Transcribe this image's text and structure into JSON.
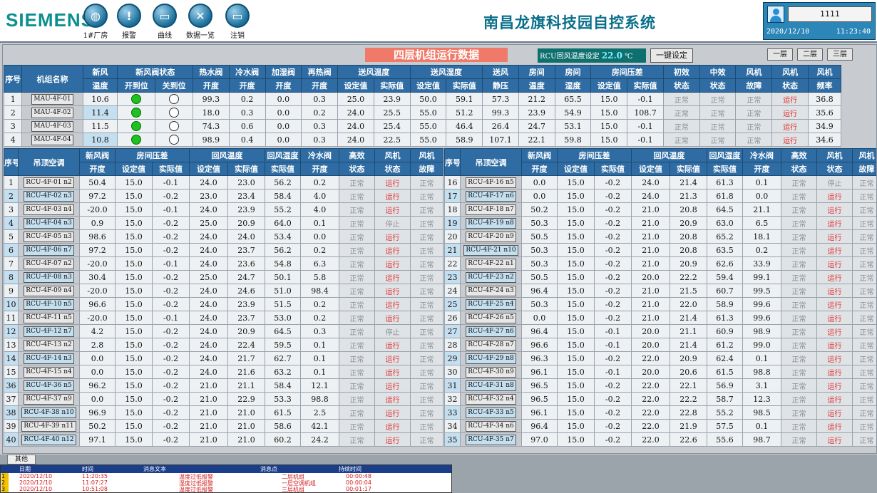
{
  "header": {
    "brand": "SIEMENS",
    "nav": [
      {
        "label": "1#厂房",
        "icon": "globe-icon",
        "glyph": "◍"
      },
      {
        "label": "报警",
        "icon": "alarm-warning-icon",
        "glyph": "!"
      },
      {
        "label": "曲线",
        "icon": "folder-curve-icon",
        "glyph": "▭"
      },
      {
        "label": "数据一览",
        "icon": "tools-icon",
        "glyph": "✕"
      },
      {
        "label": "注销",
        "icon": "folder-logout-icon",
        "glyph": "▭"
      }
    ],
    "title": "南昌龙旗科技园自控系统",
    "user": "1111",
    "date": "2020/12/10",
    "time": "11:23:40"
  },
  "panel": {
    "title": "四层机组运行数据",
    "rcu_label": "RCU回风温度设定",
    "rcu_value": "22.0",
    "rcu_unit": "℃",
    "set_button": "一键设定",
    "floors": [
      "一层",
      "二层",
      "三层"
    ]
  },
  "mau": {
    "rows": [
      {
        "no": "1",
        "name": "MAU-4F-01",
        "fresh": "10.6",
        "valve_open": true,
        "supply_valve": "99.3",
        "cold_valve": "0.2",
        "humid_valve": "0.0",
        "reheat_valve": "0.3",
        "st_set": "25.0",
        "st_act": "23.9",
        "sh_set": "50.0",
        "sh_act": "59.1",
        "static_p": "57.3",
        "room_t": "21.2",
        "room_h": "65.5",
        "rp_set": "15.0",
        "rp_act": "-0.1",
        "f1": "正常",
        "f2": "正常",
        "fault": "正常",
        "run": "运行",
        "freq": "36.8"
      },
      {
        "no": "2",
        "name": "MAU-4F-02",
        "fresh": "11.4",
        "valve_open": true,
        "supply_valve": "18.0",
        "cold_valve": "0.3",
        "humid_valve": "0.0",
        "reheat_valve": "0.2",
        "st_set": "24.0",
        "st_act": "25.5",
        "sh_set": "55.0",
        "sh_act": "51.2",
        "static_p": "99.3",
        "room_t": "23.9",
        "room_h": "54.9",
        "rp_set": "15.0",
        "rp_act": "108.7",
        "f1": "正常",
        "f2": "正常",
        "fault": "正常",
        "run": "运行",
        "freq": "35.6"
      },
      {
        "no": "3",
        "name": "MAU-4F-03",
        "fresh": "11.5",
        "valve_open": true,
        "supply_valve": "74.3",
        "cold_valve": "0.6",
        "humid_valve": "0.0",
        "reheat_valve": "0.3",
        "st_set": "24.0",
        "st_act": "25.4",
        "sh_set": "55.0",
        "sh_act": "46.4",
        "static_p": "26.4",
        "room_t": "24.7",
        "room_h": "53.1",
        "rp_set": "15.0",
        "rp_act": "-0.1",
        "f1": "正常",
        "f2": "正常",
        "fault": "正常",
        "run": "运行",
        "freq": "34.9"
      },
      {
        "no": "4",
        "name": "MAU-4F-04",
        "fresh": "10.8",
        "valve_open": true,
        "supply_valve": "98.9",
        "cold_valve": "0.4",
        "humid_valve": "0.0",
        "reheat_valve": "0.3",
        "st_set": "24.0",
        "st_act": "22.5",
        "sh_set": "55.0",
        "sh_act": "58.9",
        "static_p": "107.1",
        "room_t": "22.1",
        "room_h": "59.8",
        "rp_set": "15.0",
        "rp_act": "-0.1",
        "f1": "正常",
        "f2": "正常",
        "fault": "正常",
        "run": "运行",
        "freq": "34.6"
      }
    ],
    "headers": {
      "no": "序号",
      "name": "机组名称",
      "fresh": "新风",
      "fresh_sub": "温度",
      "valve_state": "新风阀状态",
      "open_pos": "开到位",
      "close_pos": "关到位",
      "hot_valve": "热水阀",
      "cold_valve": "冷水阀",
      "humid_valve": "加湿阀",
      "reheat_valve": "再热阀",
      "open": "开度",
      "supply_temp": "送风温度",
      "supply_humid": "送风湿度",
      "set": "设定值",
      "act": "实际值",
      "supply_air": "送风",
      "static": "静压",
      "room": "房间",
      "temp": "温度",
      "humid": "湿度",
      "room_press": "房间压差",
      "primary": "初效",
      "medium": "中效",
      "state": "状态",
      "fan": "风机",
      "fault": "故障",
      "freq": "频率"
    }
  },
  "rcu_headers": {
    "no": "序号",
    "name": "吊顶空调",
    "fresh_valve": "新风阀",
    "open": "开度",
    "room_press": "房间压差",
    "set": "设定值",
    "act": "实际值",
    "return_temp": "回风温度",
    "return_humid": "回风湿度",
    "cold_valve": "冷水阀",
    "high_eff": "高效",
    "state": "状态",
    "fan": "风机",
    "fault": "故障"
  },
  "rcu_left": [
    {
      "no": "1",
      "name": "RCU-4F-01 n2",
      "fv": "50.4",
      "ps": "15.0",
      "pa": "-0.1",
      "ts": "24.0",
      "ta": "23.0",
      "ha": "56.2",
      "cv": "0.2",
      "he": "正常",
      "fan": "运行",
      "ft": "正常"
    },
    {
      "no": "2",
      "name": "RCU-4F-02 n3",
      "fv": "97.2",
      "ps": "15.0",
      "pa": "-0.2",
      "ts": "23.0",
      "ta": "23.4",
      "ha": "58.4",
      "cv": "4.0",
      "he": "正常",
      "fan": "运行",
      "ft": "正常"
    },
    {
      "no": "3",
      "name": "RCU-4F-03 n4",
      "fv": "-20.0",
      "ps": "15.0",
      "pa": "-0.1",
      "ts": "24.0",
      "ta": "23.9",
      "ha": "55.2",
      "cv": "4.0",
      "he": "正常",
      "fan": "运行",
      "ft": "正常"
    },
    {
      "no": "4",
      "name": "RCU-4F-04 n3",
      "fv": "0.9",
      "ps": "15.0",
      "pa": "-0.2",
      "ts": "25.0",
      "ta": "20.9",
      "ha": "64.0",
      "cv": "0.1",
      "he": "正常",
      "fan": "停止",
      "ft": "正常"
    },
    {
      "no": "5",
      "name": "RCU-4F-05 n3",
      "fv": "98.6",
      "ps": "15.0",
      "pa": "-0.2",
      "ts": "24.0",
      "ta": "24.0",
      "ha": "53.4",
      "cv": "0.0",
      "he": "正常",
      "fan": "运行",
      "ft": "正常"
    },
    {
      "no": "6",
      "name": "RCU-4F-06 n7",
      "fv": "97.2",
      "ps": "15.0",
      "pa": "-0.2",
      "ts": "24.0",
      "ta": "23.7",
      "ha": "56.2",
      "cv": "0.2",
      "he": "正常",
      "fan": "运行",
      "ft": "正常"
    },
    {
      "no": "7",
      "name": "RCU-4F-07 n2",
      "fv": "-20.0",
      "ps": "15.0",
      "pa": "-0.1",
      "ts": "24.0",
      "ta": "23.6",
      "ha": "54.8",
      "cv": "6.3",
      "he": "正常",
      "fan": "运行",
      "ft": "正常"
    },
    {
      "no": "8",
      "name": "RCU-4F-08 n3",
      "fv": "30.4",
      "ps": "15.0",
      "pa": "-0.2",
      "ts": "25.0",
      "ta": "24.7",
      "ha": "50.1",
      "cv": "5.8",
      "he": "正常",
      "fan": "运行",
      "ft": "正常"
    },
    {
      "no": "9",
      "name": "RCU-4F-09 n4",
      "fv": "-20.0",
      "ps": "15.0",
      "pa": "-0.2",
      "ts": "24.0",
      "ta": "24.6",
      "ha": "51.0",
      "cv": "98.4",
      "he": "正常",
      "fan": "运行",
      "ft": "正常"
    },
    {
      "no": "10",
      "name": "RCU-4F-10 n5",
      "fv": "96.6",
      "ps": "15.0",
      "pa": "-0.2",
      "ts": "24.0",
      "ta": "23.9",
      "ha": "51.5",
      "cv": "0.2",
      "he": "正常",
      "fan": "运行",
      "ft": "正常"
    },
    {
      "no": "11",
      "name": "RCU-4F-11 n5",
      "fv": "-20.0",
      "ps": "15.0",
      "pa": "-0.1",
      "ts": "24.0",
      "ta": "23.7",
      "ha": "53.0",
      "cv": "0.2",
      "he": "正常",
      "fan": "运行",
      "ft": "正常"
    },
    {
      "no": "12",
      "name": "RCU-4F-12 n7",
      "fv": "4.2",
      "ps": "15.0",
      "pa": "-0.2",
      "ts": "24.0",
      "ta": "20.9",
      "ha": "64.5",
      "cv": "0.3",
      "he": "正常",
      "fan": "停止",
      "ft": "正常"
    },
    {
      "no": "13",
      "name": "RCU-4F-13 n2",
      "fv": "2.8",
      "ps": "15.0",
      "pa": "-0.2",
      "ts": "24.0",
      "ta": "22.4",
      "ha": "59.5",
      "cv": "0.1",
      "he": "正常",
      "fan": "运行",
      "ft": "正常"
    },
    {
      "no": "14",
      "name": "RCU-4F-14 n3",
      "fv": "0.0",
      "ps": "15.0",
      "pa": "-0.2",
      "ts": "24.0",
      "ta": "21.7",
      "ha": "62.7",
      "cv": "0.1",
      "he": "正常",
      "fan": "运行",
      "ft": "正常"
    },
    {
      "no": "15",
      "name": "RCU-4F-15 n4",
      "fv": "0.0",
      "ps": "15.0",
      "pa": "-0.2",
      "ts": "24.0",
      "ta": "21.6",
      "ha": "63.2",
      "cv": "0.1",
      "he": "正常",
      "fan": "运行",
      "ft": "正常"
    },
    {
      "no": "36",
      "name": "RCU-4F-36 n5",
      "fv": "96.2",
      "ps": "15.0",
      "pa": "-0.2",
      "ts": "21.0",
      "ta": "21.1",
      "ha": "58.4",
      "cv": "12.1",
      "he": "正常",
      "fan": "运行",
      "ft": "正常"
    },
    {
      "no": "37",
      "name": "RCU-4F-37 n9",
      "fv": "0.0",
      "ps": "15.0",
      "pa": "-0.2",
      "ts": "21.0",
      "ta": "22.9",
      "ha": "53.3",
      "cv": "98.8",
      "he": "正常",
      "fan": "运行",
      "ft": "正常"
    },
    {
      "no": "38",
      "name": "RCU-4F-38 n10",
      "fv": "96.9",
      "ps": "15.0",
      "pa": "-0.2",
      "ts": "21.0",
      "ta": "21.0",
      "ha": "61.5",
      "cv": "2.5",
      "he": "正常",
      "fan": "运行",
      "ft": "正常"
    },
    {
      "no": "39",
      "name": "RCU-4F-39 n11",
      "fv": "50.2",
      "ps": "15.0",
      "pa": "-0.2",
      "ts": "21.0",
      "ta": "21.0",
      "ha": "58.6",
      "cv": "42.1",
      "he": "正常",
      "fan": "运行",
      "ft": "正常"
    },
    {
      "no": "40",
      "name": "RCU-4F-40 n12",
      "fv": "97.1",
      "ps": "15.0",
      "pa": "-0.2",
      "ts": "21.0",
      "ta": "21.0",
      "ha": "60.2",
      "cv": "24.2",
      "he": "正常",
      "fan": "运行",
      "ft": "正常"
    }
  ],
  "rcu_right": [
    {
      "no": "16",
      "name": "RCU-4F-16 n5",
      "fv": "0.0",
      "ps": "15.0",
      "pa": "-0.2",
      "ts": "24.0",
      "ta": "21.4",
      "ha": "61.3",
      "cv": "0.1",
      "he": "正常",
      "fan": "停止",
      "ft": "正常"
    },
    {
      "no": "17",
      "name": "RCU-4F-17 n6",
      "fv": "0.0",
      "ps": "15.0",
      "pa": "-0.2",
      "ts": "24.0",
      "ta": "21.3",
      "ha": "61.8",
      "cv": "0.0",
      "he": "正常",
      "fan": "运行",
      "ft": "正常"
    },
    {
      "no": "18",
      "name": "RCU-4F-18 n7",
      "fv": "50.2",
      "ps": "15.0",
      "pa": "-0.2",
      "ts": "21.0",
      "ta": "20.8",
      "ha": "64.5",
      "cv": "21.1",
      "he": "正常",
      "fan": "运行",
      "ft": "正常"
    },
    {
      "no": "19",
      "name": "RCU-4F-19 n8",
      "fv": "50.3",
      "ps": "15.0",
      "pa": "-0.2",
      "ts": "21.0",
      "ta": "20.9",
      "ha": "63.0",
      "cv": "6.5",
      "he": "正常",
      "fan": "运行",
      "ft": "正常"
    },
    {
      "no": "20",
      "name": "RCU-4F-20 n9",
      "fv": "50.5",
      "ps": "15.0",
      "pa": "-0.2",
      "ts": "21.0",
      "ta": "20.8",
      "ha": "65.2",
      "cv": "18.1",
      "he": "正常",
      "fan": "运行",
      "ft": "正常"
    },
    {
      "no": "21",
      "name": "RCU-4F-21 n10",
      "fv": "50.3",
      "ps": "15.0",
      "pa": "-0.2",
      "ts": "21.0",
      "ta": "20.8",
      "ha": "63.5",
      "cv": "0.2",
      "he": "正常",
      "fan": "运行",
      "ft": "正常"
    },
    {
      "no": "22",
      "name": "RCU-4F-22 n1",
      "fv": "50.3",
      "ps": "15.0",
      "pa": "-0.2",
      "ts": "21.0",
      "ta": "20.9",
      "ha": "62.6",
      "cv": "33.9",
      "he": "正常",
      "fan": "运行",
      "ft": "正常"
    },
    {
      "no": "23",
      "name": "RCU-4F-23 n2",
      "fv": "50.5",
      "ps": "15.0",
      "pa": "-0.2",
      "ts": "20.0",
      "ta": "22.2",
      "ha": "59.4",
      "cv": "99.1",
      "he": "正常",
      "fan": "运行",
      "ft": "正常"
    },
    {
      "no": "24",
      "name": "RCU-4F-24 n3",
      "fv": "96.4",
      "ps": "15.0",
      "pa": "-0.2",
      "ts": "21.0",
      "ta": "21.5",
      "ha": "60.7",
      "cv": "99.5",
      "he": "正常",
      "fan": "运行",
      "ft": "正常"
    },
    {
      "no": "25",
      "name": "RCU-4F-25 n4",
      "fv": "50.3",
      "ps": "15.0",
      "pa": "-0.2",
      "ts": "21.0",
      "ta": "22.0",
      "ha": "58.9",
      "cv": "99.6",
      "he": "正常",
      "fan": "运行",
      "ft": "正常"
    },
    {
      "no": "26",
      "name": "RCU-4F-26 n5",
      "fv": "0.0",
      "ps": "15.0",
      "pa": "-0.2",
      "ts": "21.0",
      "ta": "21.4",
      "ha": "61.3",
      "cv": "99.6",
      "he": "正常",
      "fan": "运行",
      "ft": "正常"
    },
    {
      "no": "27",
      "name": "RCU-4F-27 n6",
      "fv": "96.4",
      "ps": "15.0",
      "pa": "-0.1",
      "ts": "20.0",
      "ta": "21.1",
      "ha": "60.9",
      "cv": "98.9",
      "he": "正常",
      "fan": "运行",
      "ft": "正常"
    },
    {
      "no": "28",
      "name": "RCU-4F-28 n7",
      "fv": "96.6",
      "ps": "15.0",
      "pa": "-0.1",
      "ts": "20.0",
      "ta": "21.4",
      "ha": "61.2",
      "cv": "99.0",
      "he": "正常",
      "fan": "运行",
      "ft": "正常"
    },
    {
      "no": "29",
      "name": "RCU-4F-29 n8",
      "fv": "96.3",
      "ps": "15.0",
      "pa": "-0.2",
      "ts": "22.0",
      "ta": "20.9",
      "ha": "62.4",
      "cv": "0.1",
      "he": "正常",
      "fan": "运行",
      "ft": "正常"
    },
    {
      "no": "30",
      "name": "RCU-4F-30 n9",
      "fv": "96.1",
      "ps": "15.0",
      "pa": "-0.1",
      "ts": "20.0",
      "ta": "20.6",
      "ha": "61.5",
      "cv": "98.8",
      "he": "正常",
      "fan": "运行",
      "ft": "正常"
    },
    {
      "no": "31",
      "name": "RCU-4F-31 n8",
      "fv": "96.5",
      "ps": "15.0",
      "pa": "-0.2",
      "ts": "22.0",
      "ta": "22.1",
      "ha": "56.9",
      "cv": "3.1",
      "he": "正常",
      "fan": "运行",
      "ft": "正常"
    },
    {
      "no": "32",
      "name": "RCU-4F-32 n4",
      "fv": "96.5",
      "ps": "15.0",
      "pa": "-0.2",
      "ts": "22.0",
      "ta": "22.2",
      "ha": "58.7",
      "cv": "12.3",
      "he": "正常",
      "fan": "运行",
      "ft": "正常"
    },
    {
      "no": "33",
      "name": "RCU-4F-33 n5",
      "fv": "96.1",
      "ps": "15.0",
      "pa": "-0.2",
      "ts": "22.0",
      "ta": "22.8",
      "ha": "55.2",
      "cv": "98.5",
      "he": "正常",
      "fan": "运行",
      "ft": "正常"
    },
    {
      "no": "34",
      "name": "RCU-4F-34 n6",
      "fv": "96.4",
      "ps": "15.0",
      "pa": "-0.2",
      "ts": "22.0",
      "ta": "21.9",
      "ha": "57.5",
      "cv": "0.1",
      "he": "正常",
      "fan": "运行",
      "ft": "正常"
    },
    {
      "no": "35",
      "name": "RCU-4F-35 n7",
      "fv": "97.0",
      "ps": "15.0",
      "pa": "-0.2",
      "ts": "22.0",
      "ta": "22.6",
      "ha": "55.6",
      "cv": "98.7",
      "he": "正常",
      "fan": "运行",
      "ft": "正常"
    }
  ],
  "footer": {
    "tab": "其他",
    "alarm_headers": [
      "日期",
      "时间",
      "消息文本",
      "消息点",
      "持续时间"
    ],
    "alarms": [
      {
        "idx": "1",
        "date": "2020/12/10",
        "time": "11:20:35",
        "text": "温度过低报警",
        "point": "二层机组",
        "dur": "00:00:48"
      },
      {
        "idx": "2",
        "date": "2020/12/10",
        "time": "11:07:27",
        "text": "湿度过低报警",
        "point": "一层空调机组",
        "dur": "00:00:04"
      },
      {
        "idx": "3",
        "date": "2020/12/10",
        "time": "10:51:08",
        "text": "温度过低报警",
        "point": "三层机组",
        "dur": "00:01:17"
      }
    ]
  }
}
